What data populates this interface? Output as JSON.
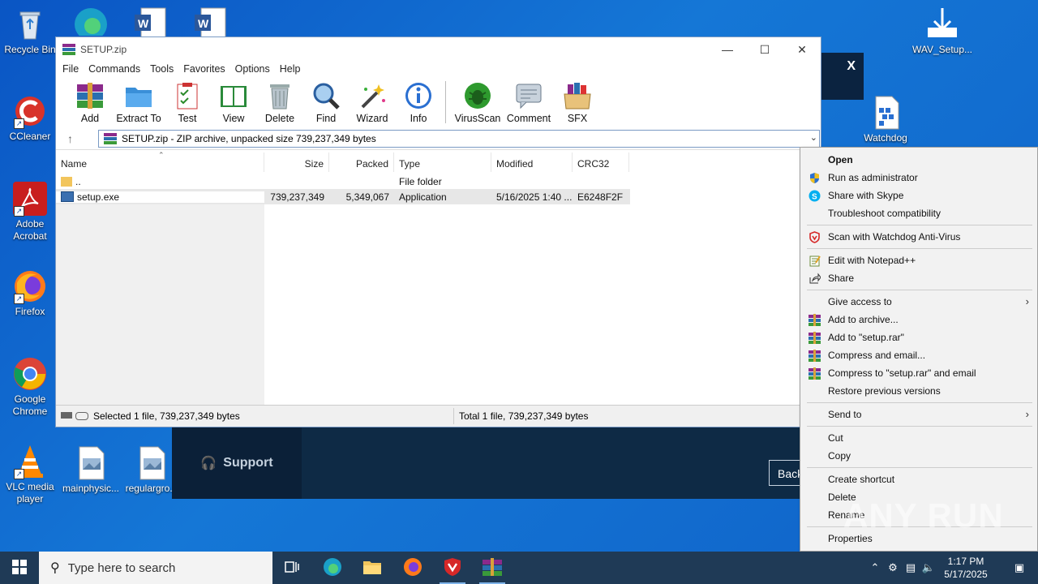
{
  "desktop": {
    "icons": [
      {
        "label": "Recycle Bin"
      },
      {
        "label": "CCleaner"
      },
      {
        "label": "Adobe Acrobat"
      },
      {
        "label": "Firefox"
      },
      {
        "label": "Google Chrome"
      },
      {
        "label": "VLC media player"
      },
      {
        "label": "mainphysic..."
      },
      {
        "label": "regulargro..."
      },
      {
        "label": "WAV_Setup..."
      },
      {
        "label": "Watchdog"
      }
    ]
  },
  "background_app": {
    "close_label": "X",
    "support_label": "Support",
    "back_label": "Back"
  },
  "winrar": {
    "title": "SETUP.zip",
    "menu": [
      "File",
      "Commands",
      "Tools",
      "Favorites",
      "Options",
      "Help"
    ],
    "toolbar": [
      "Add",
      "Extract To",
      "Test",
      "View",
      "Delete",
      "Find",
      "Wizard",
      "Info",
      "VirusScan",
      "Comment",
      "SFX"
    ],
    "address": "SETUP.zip - ZIP archive, unpacked size 739,237,349 bytes",
    "columns": [
      "Name",
      "Size",
      "Packed",
      "Type",
      "Modified",
      "CRC32"
    ],
    "rows": [
      {
        "name": "..",
        "size": "",
        "packed": "",
        "type": "File folder",
        "modified": "",
        "crc": ""
      },
      {
        "name": "setup.exe",
        "size": "739,237,349",
        "packed": "5,349,067",
        "type": "Application",
        "modified": "5/16/2025 1:40 ...",
        "crc": "E6248F2F"
      }
    ],
    "status_left": "Selected 1 file, 739,237,349 bytes",
    "status_right": "Total 1 file, 739,237,349 bytes"
  },
  "context_menu": {
    "open": "Open",
    "run_admin": "Run as administrator",
    "skype": "Share with Skype",
    "troubleshoot": "Troubleshoot compatibility",
    "scan": "Scan with Watchdog Anti-Virus",
    "notepad": "Edit with Notepad++",
    "share": "Share",
    "give_access": "Give access to",
    "add_archive": "Add to archive...",
    "add_rar": "Add to \"setup.rar\"",
    "compress_email": "Compress and email...",
    "compress_rar_email": "Compress to \"setup.rar\" and email",
    "restore": "Restore previous versions",
    "send_to": "Send to",
    "cut": "Cut",
    "copy": "Copy",
    "create_shortcut": "Create shortcut",
    "delete": "Delete",
    "rename": "Rename",
    "properties": "Properties"
  },
  "taskbar": {
    "search_placeholder": "Type here to search",
    "time": "1:17 PM",
    "date": "5/17/2025"
  },
  "watermark": "ANY RUN"
}
